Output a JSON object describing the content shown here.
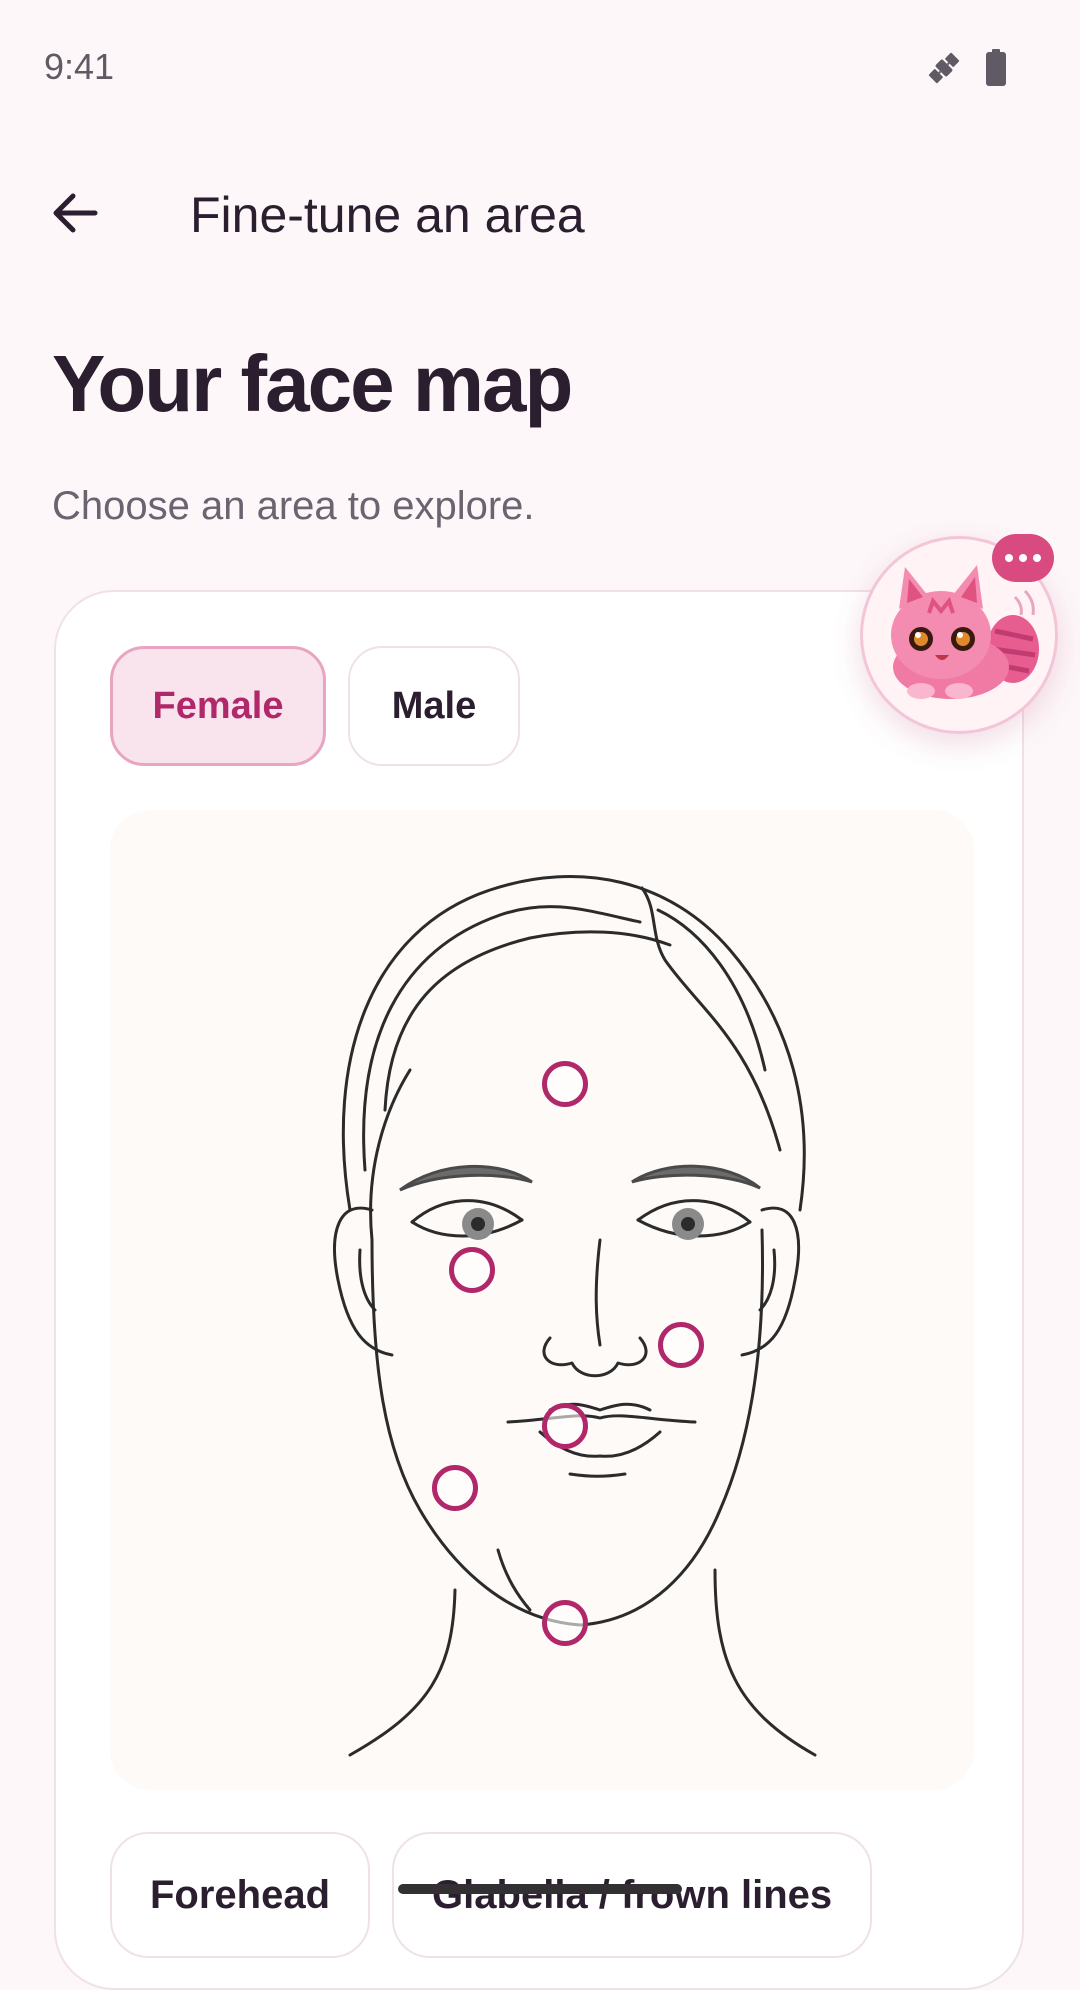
{
  "status_bar": {
    "time": "9:41",
    "icons": [
      "satellite-icon",
      "battery-icon"
    ]
  },
  "app_bar": {
    "back_icon": "arrow-left-icon",
    "title": "Fine-tune an area"
  },
  "page": {
    "heading": "Your face map",
    "subtitle": "Choose an area to explore."
  },
  "gender_toggle": {
    "options": [
      "Female",
      "Male"
    ],
    "selected": "Female"
  },
  "face_map": {
    "hotspots": [
      "forehead",
      "under-eye",
      "cheek",
      "lips",
      "jawline",
      "neck"
    ]
  },
  "area_chips": [
    "Forehead",
    "Glabella / frown lines"
  ],
  "mascot": {
    "icon": "pink-cat-mascot-icon",
    "bubble_icon": "chat-bubble-icon"
  },
  "colors": {
    "accent": "#b1286a",
    "background": "#fdf7f9",
    "chip_selected_bg": "#f9e4ed"
  }
}
